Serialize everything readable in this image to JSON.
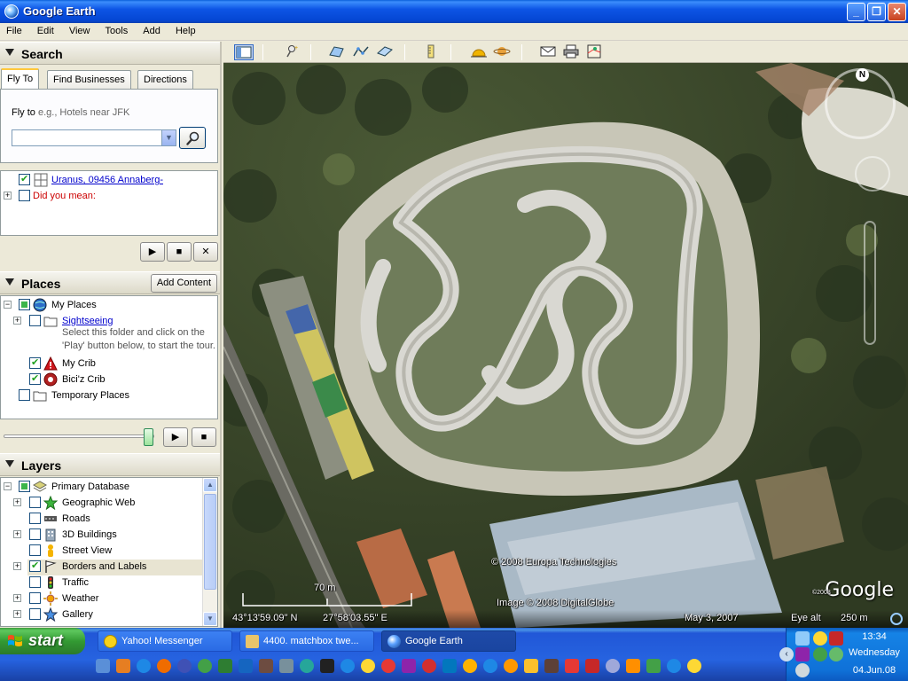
{
  "window": {
    "title": "Google Earth"
  },
  "menu": [
    "File",
    "Edit",
    "View",
    "Tools",
    "Add",
    "Help"
  ],
  "search": {
    "header": "Search",
    "tabs": [
      "Fly To",
      "Find Businesses",
      "Directions"
    ],
    "flyto_label": "Fly to",
    "flyto_hint": "e.g., Hotels near JFK",
    "input_value": "",
    "results": [
      {
        "label": "Uranus, 09456 Annaberg-",
        "checked": true
      },
      {
        "label": "Did you mean:",
        "checked": false
      }
    ]
  },
  "places": {
    "header": "Places",
    "add_content": "Add Content",
    "items": [
      {
        "label": "My Places"
      },
      {
        "label": "Sightseeing"
      },
      {
        "label": "Select this folder and click on the 'Play' button below, to start the tour."
      },
      {
        "label": "My Crib"
      },
      {
        "label": "Bici'z Crib"
      },
      {
        "label": "Temporary Places"
      }
    ]
  },
  "layers": {
    "header": "Layers",
    "items": [
      {
        "label": "Primary Database"
      },
      {
        "label": "Geographic Web"
      },
      {
        "label": "Roads"
      },
      {
        "label": "3D Buildings"
      },
      {
        "label": "Street View"
      },
      {
        "label": "Borders and Labels"
      },
      {
        "label": "Traffic"
      },
      {
        "label": "Weather"
      },
      {
        "label": "Gallery"
      }
    ]
  },
  "map": {
    "copyright1": "© 2008 Europa Technologies",
    "copyright2": "Image © 2008 DigitalGlobe",
    "scale_label": "70 m",
    "lat": "43°13'59.09\" N",
    "lon": "27°58'03.55\" E",
    "date": "May 3, 2007",
    "eye_alt_label": "Eye alt",
    "eye_alt_value": "250 m",
    "logo": "Google",
    "logo_small": "©2008",
    "north": "N"
  },
  "taskbar": {
    "start": "start",
    "tasks": [
      "Yahoo! Messenger",
      "4400. matchbox twe...",
      "Google Earth"
    ],
    "time": "13:34",
    "day": "Wednesday",
    "date": "04.Jun.08"
  },
  "colors": {
    "title_blue": "#0d55e5",
    "panel": "#ece9d8",
    "accent_green": "#3bb54a"
  }
}
